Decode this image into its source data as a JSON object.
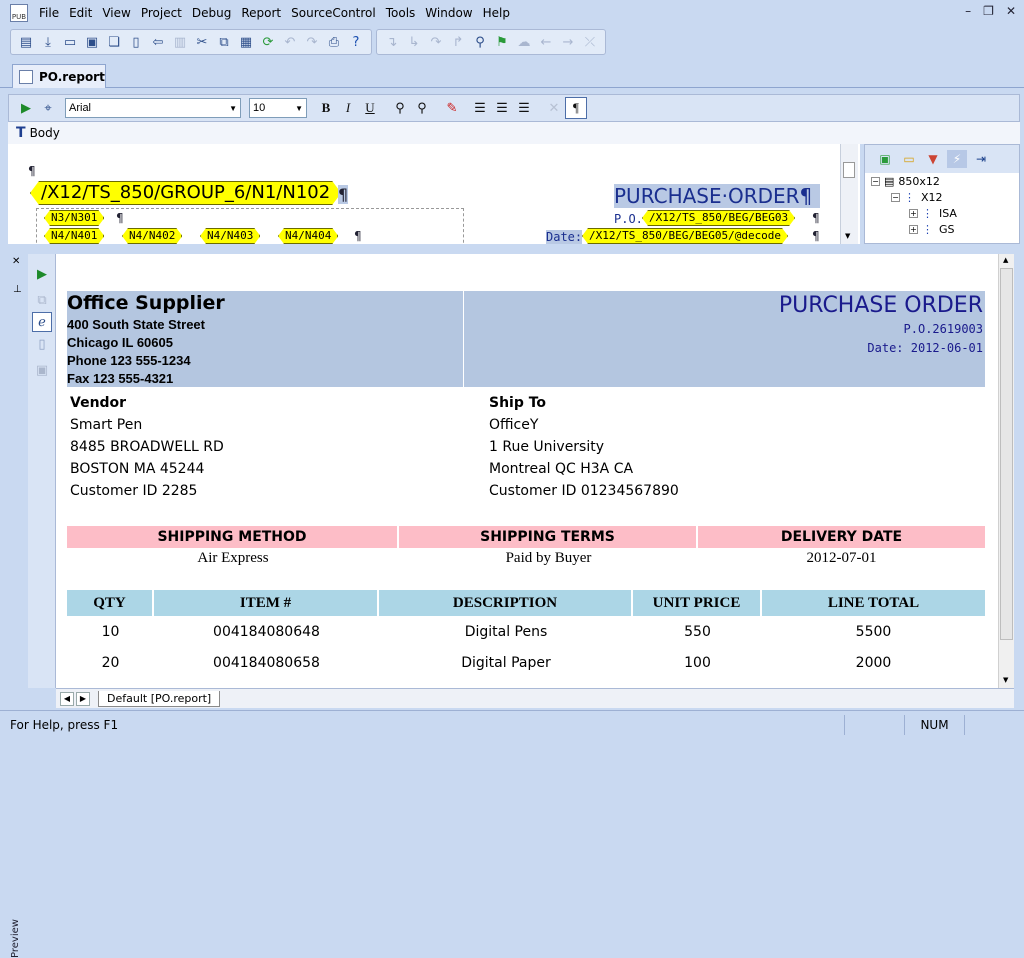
{
  "menu": [
    "File",
    "Edit",
    "View",
    "Project",
    "Debug",
    "Report",
    "SourceControl",
    "Tools",
    "Window",
    "Help"
  ],
  "app_icon_label": "PUB",
  "doc_tab": "PO.report",
  "format": {
    "font": "Arial",
    "size": "10"
  },
  "body_label": "Body",
  "design": {
    "pilcrow_top": "¶",
    "tag_main": "/X12/TS_850/GROUP_6/N1/N102",
    "tag_n301": "N3/N301",
    "tag_n401": "N4/N401",
    "tag_n402": "N4/N402",
    "tag_n403": "N4/N403",
    "tag_n404": "N4/N404",
    "pilcrow": "¶",
    "title": "PURCHASE·ORDER¶",
    "po_label": "P.O.",
    "po_tag": "/X12/TS_850/BEG/BEG03",
    "date_label": "Date:",
    "date_tag": "/X12/TS_850/BEG/BEG05/@decode"
  },
  "tree": {
    "root": "850x12",
    "child": "X12",
    "items": [
      "ISA",
      "GS"
    ]
  },
  "preview_label": "Preview",
  "report": {
    "company": {
      "name": "Office Supplier",
      "line1": "400 South State Street",
      "line2": "Chicago IL 60605",
      "line3": "Phone 123 555-1234",
      "line4": "Fax 123 555-4321"
    },
    "title": "PURCHASE ORDER",
    "po": "P.O.2619003",
    "date": "Date: 2012-06-01",
    "vendor": {
      "heading": "Vendor",
      "name": "Smart Pen",
      "street": "8485 BROADWELL RD",
      "city": "BOSTON MA 45244",
      "customer": "Customer ID 2285"
    },
    "shipto": {
      "heading": "Ship To",
      "name": "OfficeY",
      "street": "1 Rue University",
      "city": "Montreal QC H3A CA",
      "customer": "Customer ID 01234567890"
    },
    "shipping": {
      "headers": [
        "SHIPPING METHOD",
        "SHIPPING TERMS",
        "DELIVERY DATE"
      ],
      "values": [
        "Air Express",
        "Paid by Buyer",
        "2012-07-01"
      ]
    },
    "items": {
      "headers": [
        "QTY",
        "ITEM #",
        "DESCRIPTION",
        "UNIT PRICE",
        "LINE TOTAL"
      ],
      "rows": [
        [
          "10",
          "004184080648",
          "Digital Pens",
          "550",
          "5500"
        ],
        [
          "20",
          "004184080658",
          "Digital Paper",
          "100",
          "2000"
        ]
      ]
    }
  },
  "preview_tab": "Default [PO.report]",
  "status": {
    "message": "For Help, press F1",
    "num": "NUM"
  }
}
